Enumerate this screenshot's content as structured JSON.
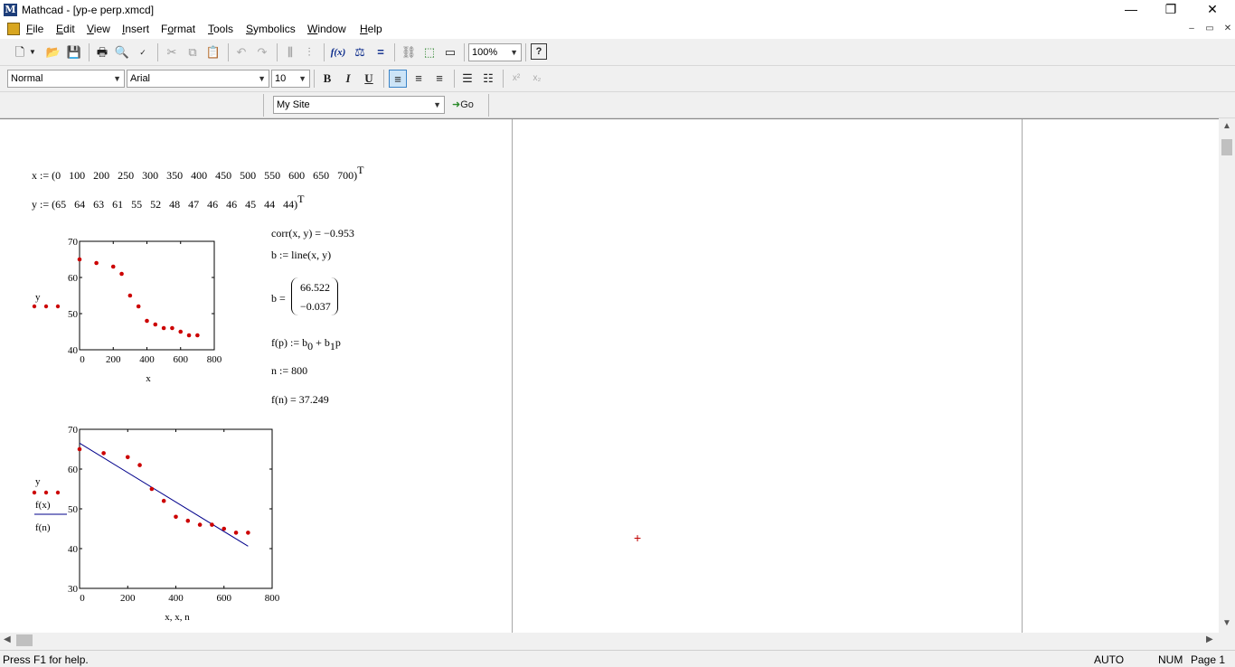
{
  "window": {
    "title": "Mathcad - [yp-e perp.xmcd]",
    "app_icon_letter": "M",
    "min_glyph": "—",
    "max_glyph": "❐",
    "close_glyph": "✕"
  },
  "menu": {
    "items": [
      {
        "label": "File",
        "key": "F",
        "rest": "ile"
      },
      {
        "label": "Edit",
        "key": "E",
        "rest": "dit"
      },
      {
        "label": "View",
        "key": "V",
        "rest": "iew"
      },
      {
        "label": "Insert",
        "key": "I",
        "rest": "nsert"
      },
      {
        "label": "Format",
        "key": "o",
        "pre": "F",
        "rest": "rmat"
      },
      {
        "label": "Tools",
        "key": "T",
        "rest": "ools"
      },
      {
        "label": "Symbolics",
        "key": "S",
        "rest": "ymbolics"
      },
      {
        "label": "Window",
        "key": "W",
        "rest": "indow"
      },
      {
        "label": "Help",
        "key": "H",
        "rest": "elp"
      }
    ],
    "mdi_min": "–",
    "mdi_restore": "▭",
    "mdi_close": "✕"
  },
  "toolbar": {
    "zoom": "100%",
    "help_glyph": "?"
  },
  "format_bar": {
    "style": "Normal",
    "font": "Arial",
    "size": "10",
    "bold": "B",
    "italic": "I",
    "underline": "U",
    "superscript": "x²",
    "subscript": "x₂"
  },
  "resource_bar": {
    "site": "My Site",
    "go": "Go"
  },
  "worksheet": {
    "x_def": "x := (0   100   200   250   300   350   400   450   500   550   600   650   700)",
    "y_def": "y := (65   64   63   61   55   52   48   47   46   46   45   44   44)",
    "transpose": "T",
    "corr": "corr(x, y) = −0.953",
    "b_def": "b := line(x, y)",
    "b_label": "b =",
    "b_values": [
      "66.522",
      "−0.037"
    ],
    "f_def_a": "f(p) := b",
    "f_def_b": " + b",
    "f_def_c": "p",
    "sub0": "0",
    "sub1": "1",
    "n_def": "n := 800",
    "fn_result": "f(n) = 37.249",
    "cursor": "+"
  },
  "chart_data": [
    {
      "type": "scatter",
      "title": "",
      "xlabel": "x",
      "ylabel": "y",
      "xlim": [
        0,
        800
      ],
      "ylim": [
        40,
        70
      ],
      "xticks": [
        "0",
        "200",
        "400",
        "600",
        "800"
      ],
      "yticks": [
        "40",
        "50",
        "60",
        "70"
      ],
      "series": [
        {
          "name": "y",
          "color": "#cc0000",
          "x": [
            0,
            100,
            200,
            250,
            300,
            350,
            400,
            450,
            500,
            550,
            600,
            650,
            700
          ],
          "y": [
            65,
            64,
            63,
            61,
            55,
            52,
            48,
            47,
            46,
            46,
            45,
            44,
            44
          ]
        }
      ]
    },
    {
      "type": "scatter",
      "title": "",
      "xlabel": "x, x, n",
      "ylabel_lines": [
        "y",
        "f(x)",
        "f(n)"
      ],
      "xlim": [
        0,
        800
      ],
      "ylim": [
        30,
        70
      ],
      "xticks": [
        "0",
        "200",
        "400",
        "600",
        "800"
      ],
      "yticks": [
        "30",
        "40",
        "50",
        "60",
        "70"
      ],
      "series": [
        {
          "name": "y",
          "color": "#cc0000",
          "x": [
            0,
            100,
            200,
            250,
            300,
            350,
            400,
            450,
            500,
            550,
            600,
            650,
            700
          ],
          "y": [
            65,
            64,
            63,
            61,
            55,
            52,
            48,
            47,
            46,
            46,
            45,
            44,
            44
          ]
        },
        {
          "name": "f(x)",
          "color": "#00008b",
          "line": true,
          "x": [
            0,
            700
          ],
          "y": [
            66.522,
            40.6
          ]
        }
      ]
    }
  ],
  "status": {
    "help": "Press F1 for help.",
    "auto": "AUTO",
    "num": "NUM",
    "page": "Page 1"
  }
}
